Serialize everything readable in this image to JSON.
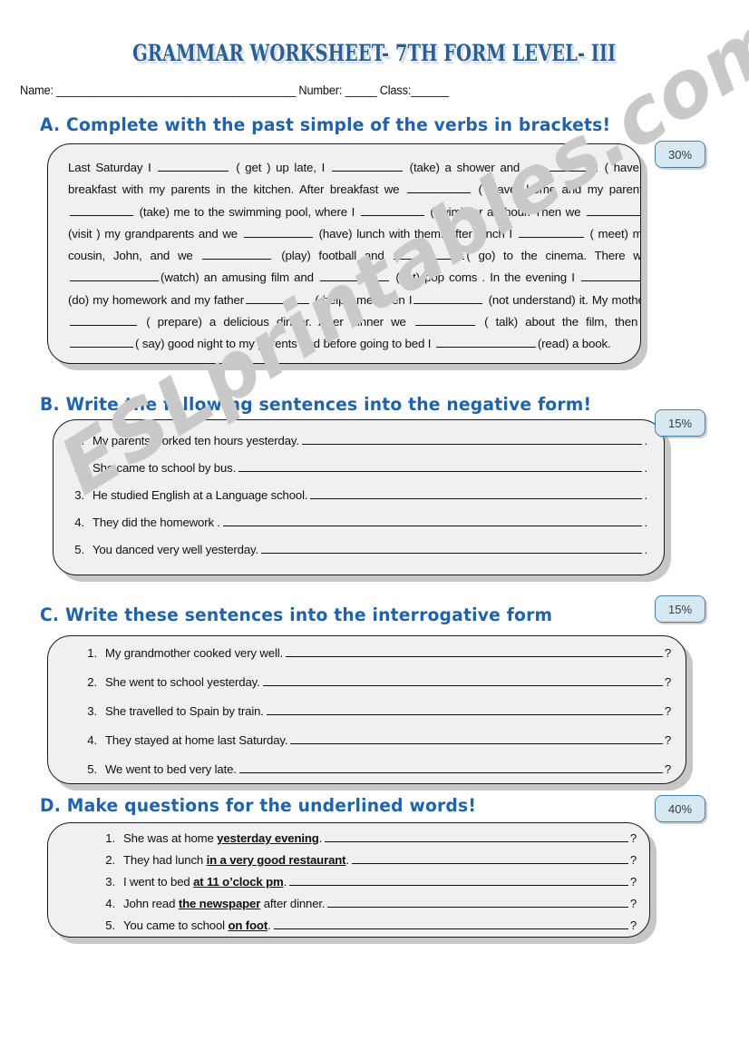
{
  "document": {
    "title": "GRAMMAR WORKSHEET- 7TH FORM LEVEL- III",
    "watermark": "ESLprintables.com",
    "name_line": "Name: ______________________________________ Number: _____ Class:______"
  },
  "sections": [
    {
      "id": "A",
      "heading": "A. Complete with the past simple of the verbs in brackets!",
      "weight": "30%",
      "type": "cloze",
      "paragraph_parts": [
        {
          "t": "Last Saturday I "
        },
        {
          "b": 78
        },
        {
          "t": " ( get ) up late, I "
        },
        {
          "b": 78
        },
        {
          "t": " (take)  a shower and "
        },
        {
          "b": 78
        },
        {
          "t": " ( have ) breakfast  with  my  parents   in the  kitchen.   After  breakfast  we "
        },
        {
          "b": 70
        },
        {
          "t": " ( leave) home and my parents "
        },
        {
          "b": 70
        },
        {
          "t": " (take) me to the swimming pool, where I "
        },
        {
          "b": 70
        },
        {
          "t": " (swim) for an hour.   Then we "
        },
        {
          "b": 66
        },
        {
          "t": " (visit ) my grandparents and we "
        },
        {
          "b": 76
        },
        {
          "t": " (have) lunch with them. After lunch I "
        },
        {
          "b": 72
        },
        {
          "t": " ( meet) my cousin, John,  and we "
        },
        {
          "b": 76
        },
        {
          "t": " (play) football and "
        },
        {
          "b": 78
        },
        {
          "t": "( go) to the cinema. There we "
        },
        {
          "b": 98
        },
        {
          "t": "(watch) an amusing film and "
        },
        {
          "b": 76
        },
        {
          "t": " (eat) pop coms . In  the  evening  I "
        },
        {
          "b": 72
        },
        {
          "t": "  (do)  my  homework  and  my  father"
        },
        {
          "b": 70
        },
        {
          "t": "  ( help )  me  when  I"
        },
        {
          "b": 76
        },
        {
          "t": " (not understand) it.   My mother "
        },
        {
          "b": 74
        },
        {
          "t": " ( prepare)  a delicious dinner.  After dinner we  "
        },
        {
          "b": 66
        },
        {
          "t": " ( talk) about the film, then I "
        },
        {
          "b": 70
        },
        {
          "t": "( say) good night to my parents  and before going to bed I "
        },
        {
          "b": 110
        },
        {
          "t": "(read) a book."
        }
      ]
    },
    {
      "id": "B",
      "heading": "B. Write the following sentences into the negative form!",
      "weight": "15%",
      "type": "rewrite",
      "end_mark": ".",
      "items": [
        {
          "n": "1.",
          "text": "My parents worked ten hours yesterday. "
        },
        {
          "n": "2.",
          "text": "She came to school by bus."
        },
        {
          "n": "3.",
          "text": "He  studied English at a Language school."
        },
        {
          "n": "4.",
          "text": "They did the homework ."
        },
        {
          "n": "5.",
          "text": "You danced very well yesterday."
        }
      ]
    },
    {
      "id": "C",
      "heading": "C. Write these sentences into the interrogative form",
      "weight": "15%",
      "type": "rewrite",
      "end_mark": "?",
      "items": [
        {
          "n": "1.",
          "text": "My grandmother cooked very well. "
        },
        {
          "n": "2.",
          "text": "She  went to school yesterday. "
        },
        {
          "n": "3.",
          "text": "She travelled to Spain by train. "
        },
        {
          "n": "4.",
          "text": "They stayed at home last Saturday.  "
        },
        {
          "n": "5.",
          "text": "We went to bed very late. "
        }
      ]
    },
    {
      "id": "D",
      "heading": "D. Make questions for the underlined words!",
      "weight": "40%",
      "type": "underlined",
      "end_mark": "?",
      "items": [
        {
          "n": "1.",
          "pre": "She was at home  ",
          "underlined": "yesterday evening",
          "post": ".  "
        },
        {
          "n": "2.",
          "pre": "They had lunch  ",
          "underlined": "in a very good restaurant",
          "post": ". "
        },
        {
          "n": "3.",
          "pre": "I went to bed ",
          "underlined": "at 11 o’clock pm",
          "post": "."
        },
        {
          "n": "4.",
          "pre": "John read ",
          "underlined": "the newspaper",
          "post": " after dinner. "
        },
        {
          "n": "5.",
          "pre": "You came to school ",
          "underlined": "on foot",
          "post": ". "
        }
      ]
    }
  ],
  "colors": {
    "heading_blue": "#1f63ad",
    "title_blue": "#2b5f93",
    "box_fill": "#f0f0f0",
    "badge_fill": "#d6e9f2",
    "badge_border": "#4a7fa5",
    "watermark_gray": "#c9c9c9"
  }
}
